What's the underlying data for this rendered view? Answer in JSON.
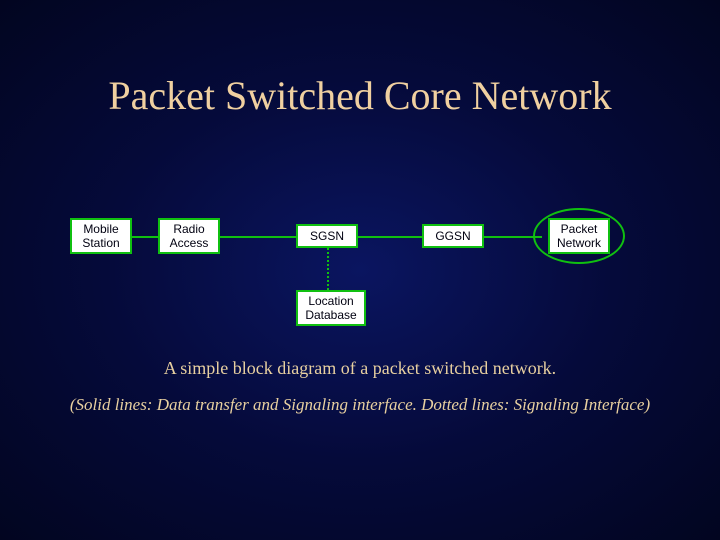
{
  "title": "Packet Switched Core Network",
  "nodes": {
    "mobile_station": "Mobile\nStation",
    "radio_access": "Radio\nAccess",
    "sgsn": "SGSN",
    "ggsn": "GGSN",
    "packet_network": "Packet\nNetwork",
    "location_database": "Location\nDatabase"
  },
  "caption": {
    "line1": "A simple block diagram of a packet switched network.",
    "line2": "(Solid lines: Data transfer and Signaling interface. Dotted lines: Signaling Interface)"
  }
}
